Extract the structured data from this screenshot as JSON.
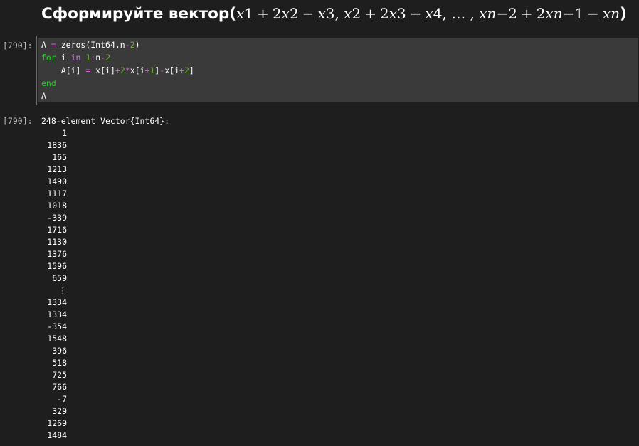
{
  "heading": {
    "text": "Сформируйте вектор(",
    "math": [
      {
        "t": "x",
        "k": "mi"
      },
      {
        "t": "1",
        "k": "mn"
      },
      {
        "t": "+",
        "k": "mo"
      },
      {
        "t": "2",
        "k": "mn"
      },
      {
        "t": "x",
        "k": "mi"
      },
      {
        "t": "2",
        "k": "mn"
      },
      {
        "t": "−",
        "k": "mo"
      },
      {
        "t": "x",
        "k": "mi"
      },
      {
        "t": "3, ",
        "k": "mn"
      },
      {
        "t": "x",
        "k": "mi"
      },
      {
        "t": "2",
        "k": "mn"
      },
      {
        "t": "+",
        "k": "mo"
      },
      {
        "t": "2",
        "k": "mn"
      },
      {
        "t": "x",
        "k": "mi"
      },
      {
        "t": "3",
        "k": "mn"
      },
      {
        "t": "−",
        "k": "mo"
      },
      {
        "t": "x",
        "k": "mi"
      },
      {
        "t": "4, … , ",
        "k": "mn"
      },
      {
        "t": "xn",
        "k": "mi"
      },
      {
        "t": "−2",
        "k": "mn"
      },
      {
        "t": "+",
        "k": "mo"
      },
      {
        "t": "2",
        "k": "mn"
      },
      {
        "t": "xn",
        "k": "mi"
      },
      {
        "t": "−1",
        "k": "mn"
      },
      {
        "t": "−",
        "k": "mo"
      },
      {
        "t": "xn",
        "k": "mi"
      }
    ],
    "close": ")"
  },
  "input_prompt": "[790]:",
  "output_prompt": "[790]:",
  "code_lines": [
    [
      {
        "t": "A ",
        "c": ""
      },
      {
        "t": "=",
        "c": "op"
      },
      {
        "t": " zeros(Int64,n",
        "c": ""
      },
      {
        "t": "-",
        "c": "op"
      },
      {
        "t": "2",
        "c": "num"
      },
      {
        "t": ")",
        "c": ""
      }
    ],
    [
      {
        "t": "for",
        "c": "kw"
      },
      {
        "t": " i ",
        "c": ""
      },
      {
        "t": "in",
        "c": "kw2"
      },
      {
        "t": " ",
        "c": ""
      },
      {
        "t": "1",
        "c": "num"
      },
      {
        "t": ":",
        "c": "op"
      },
      {
        "t": "n",
        "c": ""
      },
      {
        "t": "-",
        "c": "op"
      },
      {
        "t": "2",
        "c": "num"
      }
    ],
    [
      {
        "t": "    A[i] ",
        "c": ""
      },
      {
        "t": "=",
        "c": "op"
      },
      {
        "t": " x[i]",
        "c": ""
      },
      {
        "t": "+",
        "c": "op"
      },
      {
        "t": "2",
        "c": "num"
      },
      {
        "t": "*",
        "c": "op"
      },
      {
        "t": "x[i",
        "c": ""
      },
      {
        "t": "+",
        "c": "op"
      },
      {
        "t": "1",
        "c": "num"
      },
      {
        "t": "]",
        "c": ""
      },
      {
        "t": "-",
        "c": "op"
      },
      {
        "t": "x[i",
        "c": ""
      },
      {
        "t": "+",
        "c": "op"
      },
      {
        "t": "2",
        "c": "num"
      },
      {
        "t": "]",
        "c": ""
      }
    ],
    [
      {
        "t": "end",
        "c": "kw"
      }
    ],
    [
      {
        "t": "A",
        "c": ""
      }
    ]
  ],
  "output_header": "248-element Vector{Int64}:",
  "output_values": [
    "1",
    "1836",
    "165",
    "1213",
    "1490",
    "1117",
    "1018",
    "-339",
    "1716",
    "1130",
    "1376",
    "1596",
    "659",
    "⋮",
    "1334",
    "1334",
    "-354",
    "1548",
    "396",
    "518",
    "725",
    "766",
    "-7",
    "329",
    "1269",
    "1484"
  ]
}
